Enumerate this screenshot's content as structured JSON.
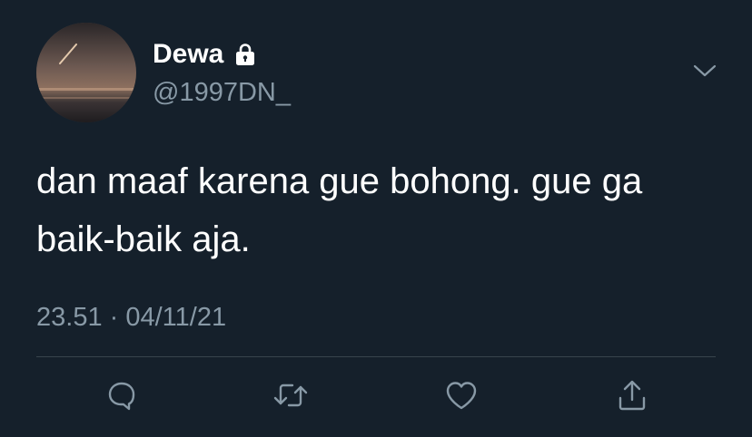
{
  "user": {
    "display_name": "Dewa",
    "handle": "@1997DN_",
    "protected_icon": "lock-icon"
  },
  "tweet": {
    "text_line1": "dan maaf karena gue bohong. gue ga",
    "text_line2": "baik-baik aja.",
    "timestamp": "23.51 · 04/11/21"
  },
  "actions": {
    "reply_icon": "comment-icon",
    "retweet_icon": "retweet-icon",
    "like_icon": "heart-icon",
    "share_icon": "share-icon"
  },
  "colors": {
    "background": "#15202b",
    "primary_text": "#ffffff",
    "secondary_text": "#8899a6",
    "divider": "#38444d"
  }
}
